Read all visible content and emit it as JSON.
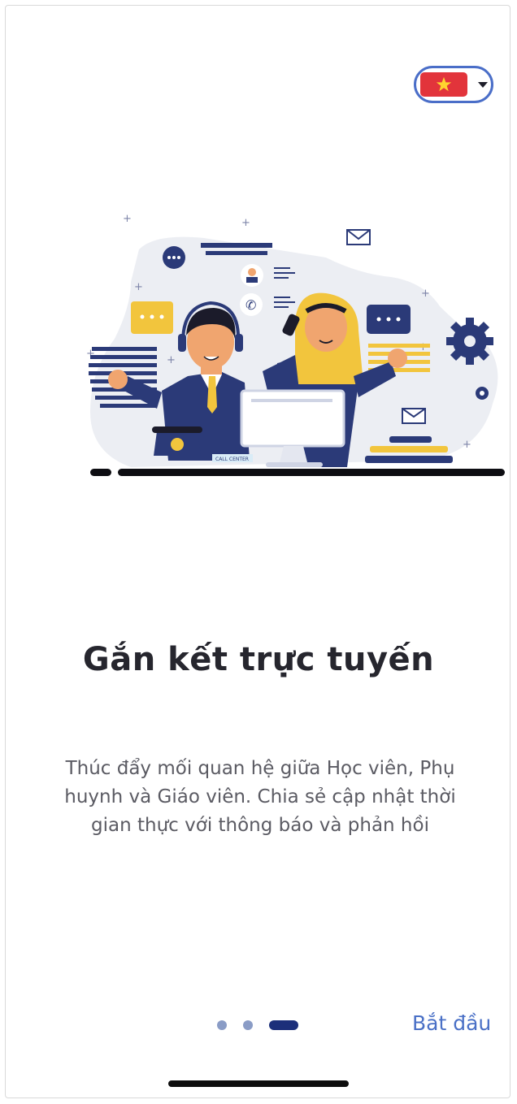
{
  "language_selector": {
    "flag_icon": "vietnam-flag-icon",
    "flag_color": "#e2343b",
    "star_color": "#ffd52e"
  },
  "onboarding": {
    "illustration": "customer-support-illustration",
    "title": "Gắn kết trực tuyến",
    "description": "Thúc đẩy mối quan hệ giữa Học viên, Phụ huynh và Giáo viên. Chia sẻ cập nhật thời gian thực với thông báo và phản hồi",
    "pagination": {
      "total": 3,
      "active": 3
    },
    "start_label": "Bắt đầu"
  },
  "colors": {
    "accent": "#4a70c6",
    "navy": "#2b3a78",
    "yellow": "#f2c53d",
    "active_dot": "#1c2f7a"
  }
}
